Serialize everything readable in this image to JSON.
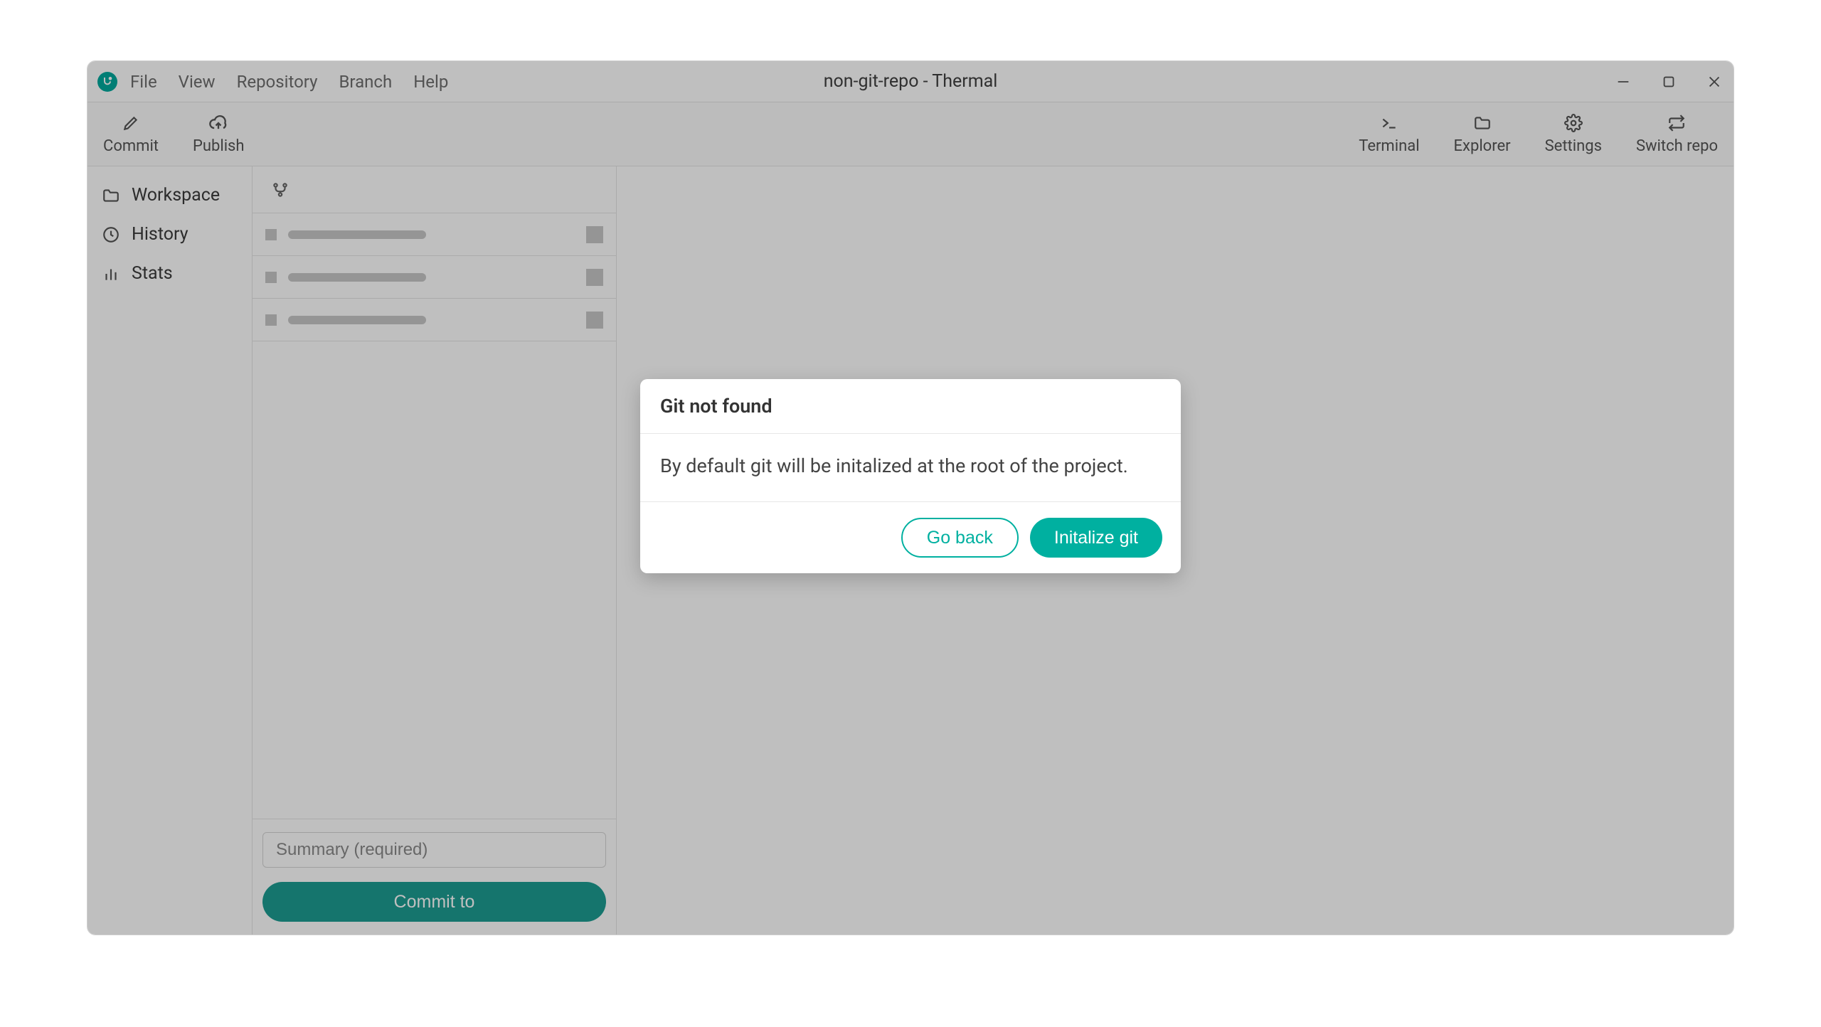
{
  "window": {
    "title": "non-git-repo - Thermal"
  },
  "menu": {
    "file": "File",
    "view": "View",
    "repository": "Repository",
    "branch": "Branch",
    "help": "Help"
  },
  "toolbar": {
    "commit": "Commit",
    "publish": "Publish",
    "terminal": "Terminal",
    "explorer": "Explorer",
    "settings": "Settings",
    "switch_repo": "Switch repo"
  },
  "sidebar": {
    "workspace": "Workspace",
    "history": "History",
    "stats": "Stats"
  },
  "commit_form": {
    "summary_placeholder": "Summary (required)",
    "commit_button": "Commit to"
  },
  "modal": {
    "title": "Git not found",
    "body": "By default git will be initalized at the root of the project.",
    "go_back": "Go back",
    "init": "Initalize git"
  },
  "colors": {
    "accent": "#00b0a0"
  }
}
